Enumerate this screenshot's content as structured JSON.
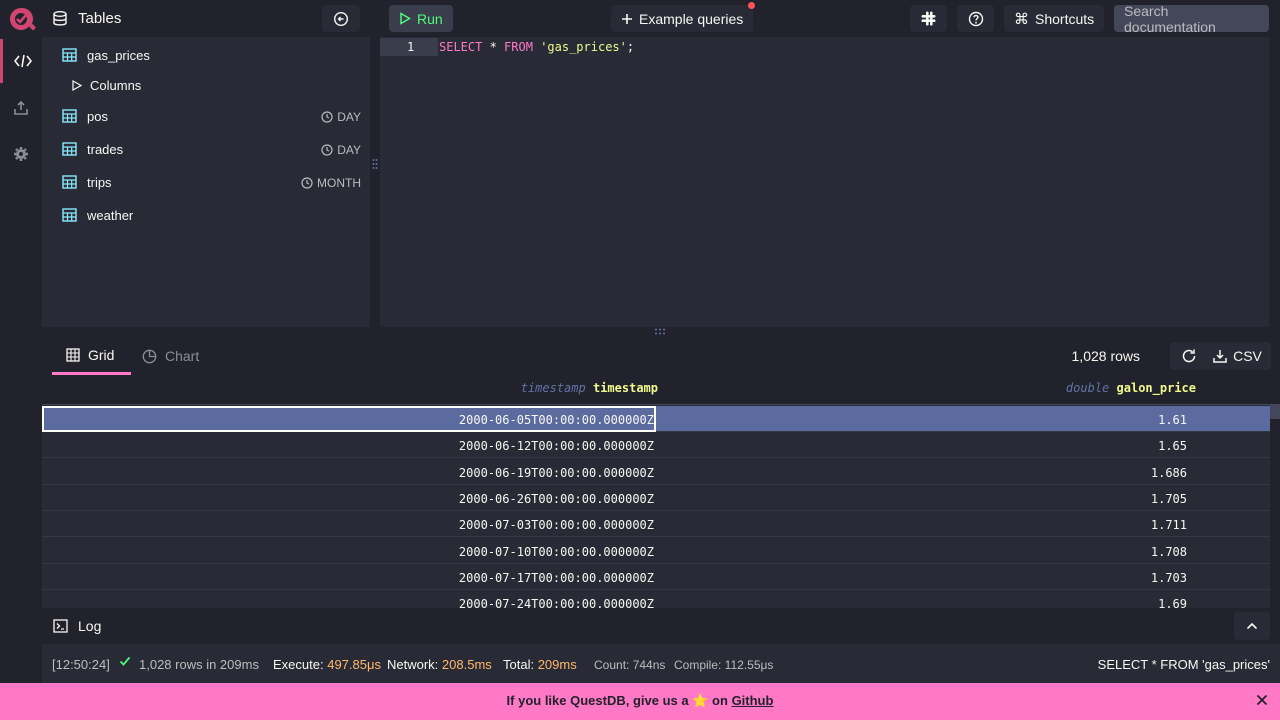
{
  "tables_panel": {
    "title": "Tables",
    "tables": [
      {
        "name": "gas_prices",
        "partition": ""
      },
      {
        "name": "pos",
        "partition": "DAY"
      },
      {
        "name": "trades",
        "partition": "DAY"
      },
      {
        "name": "trips",
        "partition": "MONTH"
      },
      {
        "name": "weather",
        "partition": ""
      }
    ],
    "columns_label": "Columns"
  },
  "toolbar": {
    "run_label": "Run",
    "examples_label": "Example queries",
    "shortcuts_label": "Shortcuts",
    "search_placeholder": "Search documentation"
  },
  "editor": {
    "line_number": "1",
    "kw1": "SELECT",
    "star": " * ",
    "kw2": "FROM",
    "space": " ",
    "str": "'gas_prices'",
    "end": ";"
  },
  "results": {
    "tab_grid": "Grid",
    "tab_chart": "Chart",
    "rows_count": "1,028 rows",
    "csv_label": "CSV",
    "columns": [
      {
        "type": "timestamp",
        "name": "timestamp"
      },
      {
        "type": "double",
        "name": "galon_price"
      }
    ],
    "rows": [
      {
        "timestamp": "2000-06-05T00:00:00.000000Z",
        "galon_price": "1.61"
      },
      {
        "timestamp": "2000-06-12T00:00:00.000000Z",
        "galon_price": "1.65"
      },
      {
        "timestamp": "2000-06-19T00:00:00.000000Z",
        "galon_price": "1.686"
      },
      {
        "timestamp": "2000-06-26T00:00:00.000000Z",
        "galon_price": "1.705"
      },
      {
        "timestamp": "2000-07-03T00:00:00.000000Z",
        "galon_price": "1.711"
      },
      {
        "timestamp": "2000-07-10T00:00:00.000000Z",
        "galon_price": "1.708"
      },
      {
        "timestamp": "2000-07-17T00:00:00.000000Z",
        "galon_price": "1.703"
      },
      {
        "timestamp": "2000-07-24T00:00:00.000000Z",
        "galon_price": "1.69"
      }
    ]
  },
  "log": {
    "title": "Log",
    "time": "[12:50:24]",
    "summary": "1,028 rows in 209ms",
    "execute_label": "Execute:",
    "execute_value": "497.85μs",
    "network_label": "Network:",
    "network_value": "208.5ms",
    "total_label": "Total:",
    "total_value": "209ms",
    "count": "Count: 744ns",
    "compile": "Compile: 112.55μs",
    "query": "SELECT * FROM 'gas_prices'"
  },
  "banner": {
    "text_before": "If you like QuestDB, give us a",
    "star": "⭐",
    "text_on": "on",
    "link": "Github"
  },
  "colors": {
    "accent": "#d14671",
    "banner": "#ff79c6",
    "run": "#50fa7b",
    "keyword": "#ff79c6",
    "string": "#f1fa8c"
  }
}
